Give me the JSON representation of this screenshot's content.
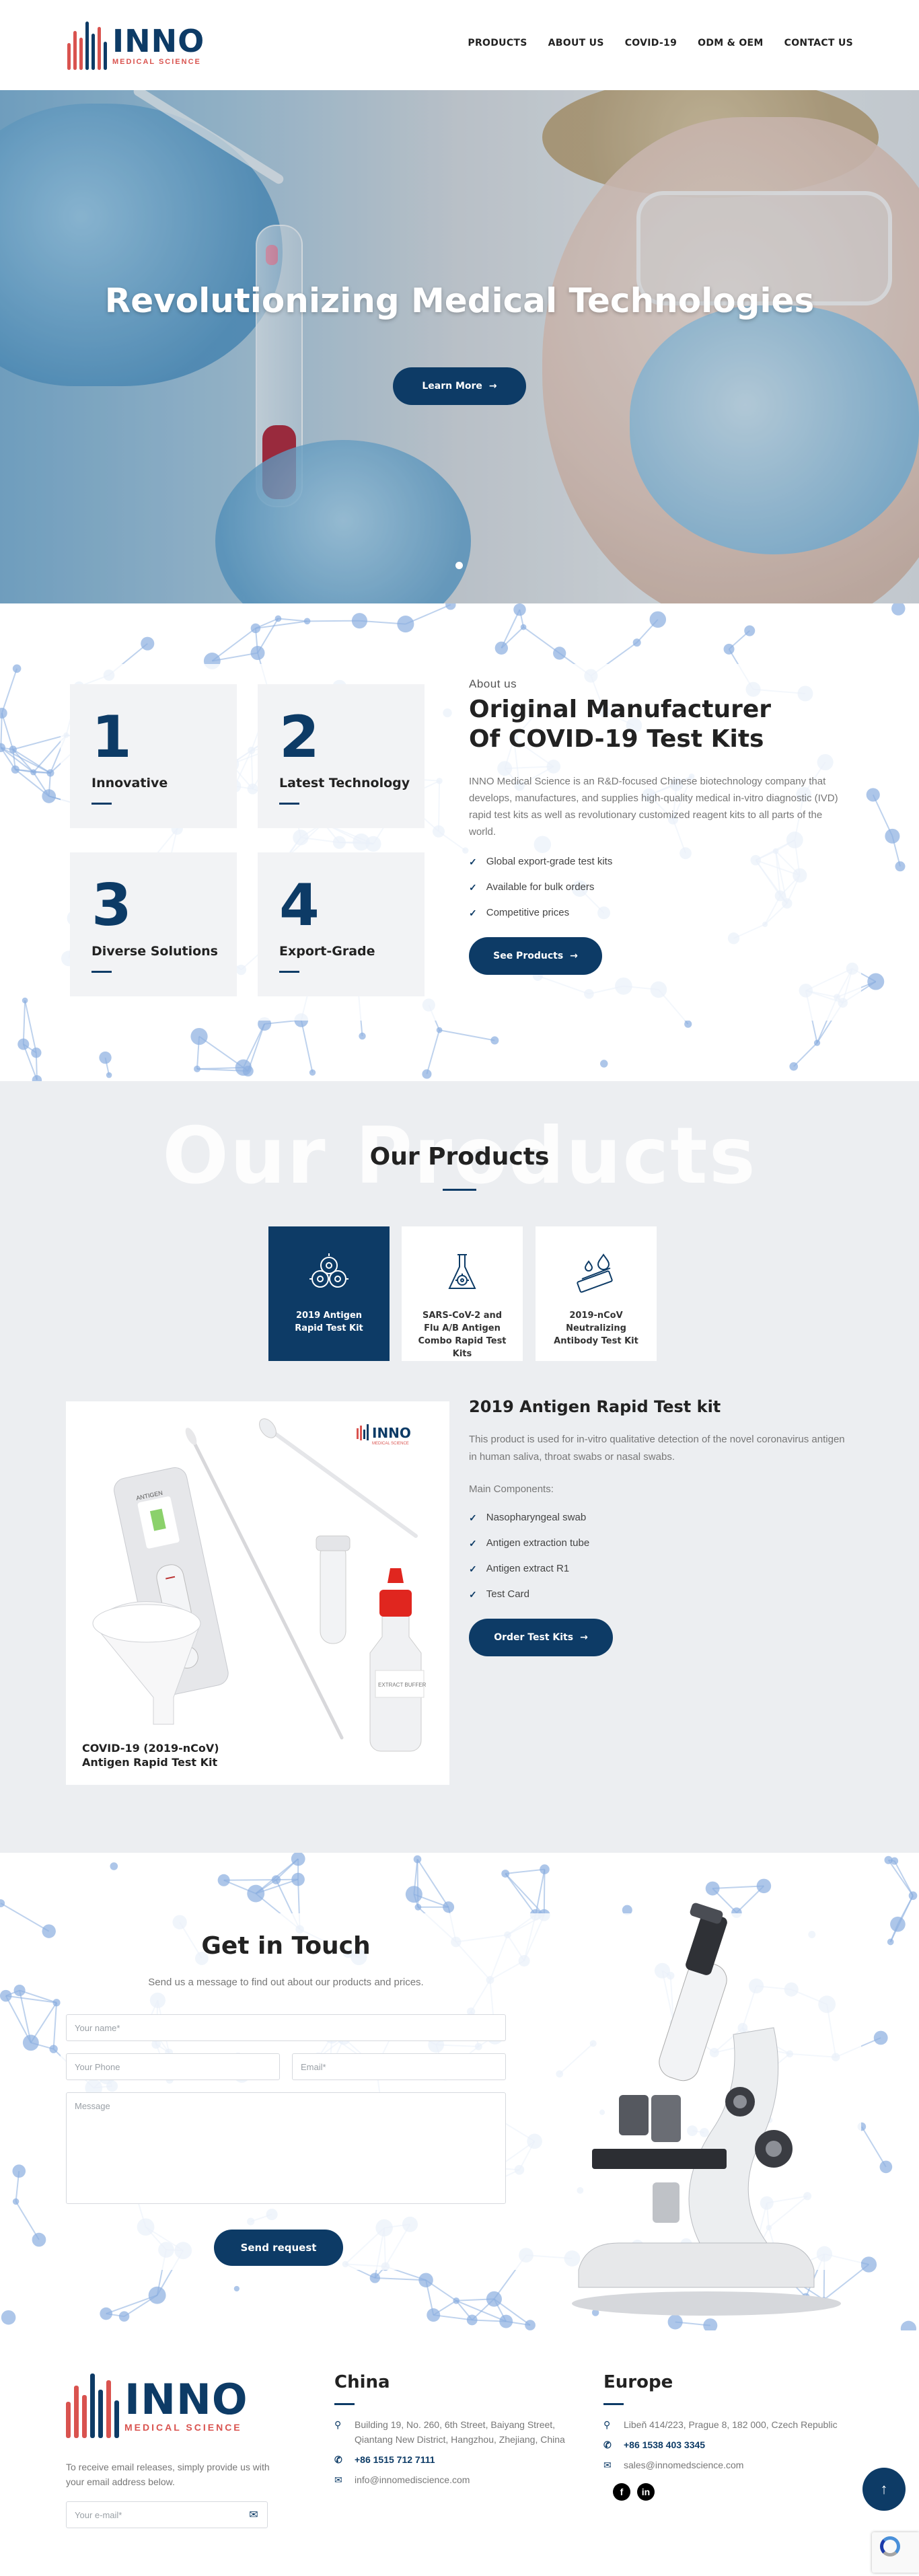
{
  "header": {
    "logo_text": "INNO",
    "logo_sub": "MEDICAL SCIENCE",
    "nav": [
      "PRODUCTS",
      "ABOUT US",
      "COVID-19",
      "ODM & OEM",
      "CONTACT US"
    ]
  },
  "hero": {
    "title": "Revolutionizing Medical Technologies",
    "button": "Learn More"
  },
  "about": {
    "stats": [
      {
        "num": "1",
        "label": "Innovative"
      },
      {
        "num": "2",
        "label": "Latest Technology"
      },
      {
        "num": "3",
        "label": "Diverse Solutions"
      },
      {
        "num": "4",
        "label": "Export-Grade"
      }
    ],
    "kicker": "About us",
    "heading_line1": "Original Manufacturer",
    "heading_line2": "Of COVID-19 Test Kits",
    "paragraph": "INNO Medical Science is an R&D-focused Chinese biotechnology company that develops, manufactures, and supplies high-quality medical in-vitro diagnostic (IVD) rapid test kits as well as revolutionary customized reagent kits to all parts of the world.",
    "bullets": [
      "Global export-grade test kits",
      "Available for bulk orders",
      "Competitive prices"
    ],
    "button": "See Products"
  },
  "products": {
    "ghost": "Our Products",
    "title": "Our Products",
    "tabs": [
      {
        "label": "2019 Antigen Rapid Test Kit"
      },
      {
        "label": "SARS-CoV-2 and Flu A/B Antigen Combo Rapid Test Kits"
      },
      {
        "label": "2019-nCoV Neutralizing Antibody Test Kit"
      }
    ],
    "image_caption_line1": "COVID-19 (2019-nCoV)",
    "image_caption_line2": "Antigen Rapid Test Kit",
    "image_logo": "INNO",
    "image_logo_sub": "MEDICAL SCIENCE",
    "kit_label": "ANTIGEN",
    "bottle_label": "EXTRACT BUFFER",
    "product_title": "2019 Antigen Rapid Test kit",
    "description": "This product is used for in-vitro qualitative detection of the novel coronavirus antigen in human saliva, throat swabs or nasal swabs.",
    "components_label": "Main Components:",
    "components": [
      "Nasopharyngeal swab",
      "Antigen extraction tube",
      "Antigen extract R1",
      "Test Card"
    ],
    "button": "Order Test Kits"
  },
  "contact": {
    "title": "Get in Touch",
    "lead": "Send us a message to find out about our products and prices.",
    "name_placeholder": "Your name*",
    "phone_placeholder": "Your Phone",
    "email_placeholder": "Email*",
    "message_placeholder": "Message",
    "button": "Send request"
  },
  "footer": {
    "text": "To receive email releases, simply provide us with your email address below.",
    "email_placeholder": "Your e-mail*",
    "china": {
      "title": "China",
      "address": "Building 19, No. 260, 6th Street, Baiyang Street, Qiantang New District, Hangzhou, Zhejiang, China",
      "phone": "+86 1515 712 7111",
      "email": "info@innomediscience.com"
    },
    "europe": {
      "title": "Europe",
      "address": "Libeň 414/223, Prague 8, 182 000, Czech Republic",
      "phone": "+86 1538 403 3345",
      "email": "sales@innomedscience.com"
    }
  },
  "colors": {
    "primary": "#0d3b66",
    "accent": "#d9534f",
    "section_gray": "#eceef1",
    "molecule": "#8aaee0"
  },
  "icons": [
    "arrow-right-icon",
    "check-icon",
    "virus-icon",
    "flask-icon",
    "microscope-icon",
    "location-icon",
    "phone-icon",
    "mail-icon",
    "facebook-icon",
    "linkedin-icon",
    "arrow-up-icon",
    "send-icon"
  ]
}
